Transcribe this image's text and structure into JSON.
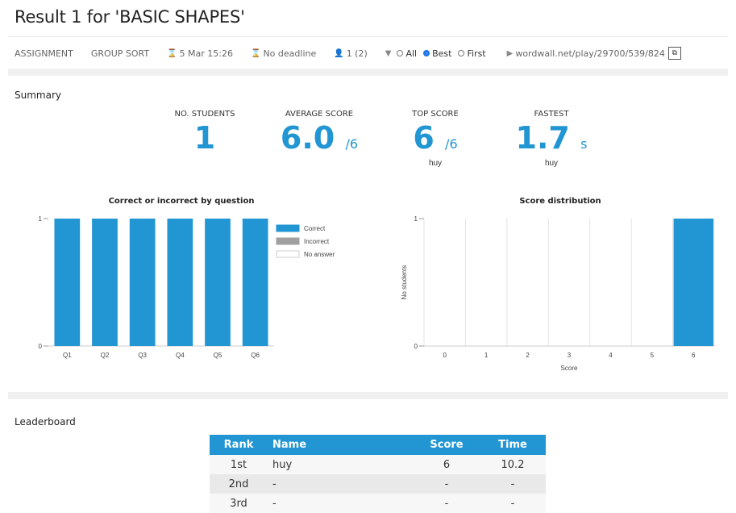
{
  "title": "Result 1 for 'BASIC SHAPES'",
  "meta": {
    "mode": "ASSIGNMENT",
    "template": "GROUP SORT",
    "started": "5 Mar 15:26",
    "deadline": "No deadline",
    "participants": "1 (2)",
    "filter_all": "All",
    "filter_best": "Best",
    "filter_first": "First",
    "link": "wordwall.net/play/29700/539/824"
  },
  "summary": {
    "label": "Summary",
    "students": {
      "header": "NO. STUDENTS",
      "value": "1"
    },
    "average": {
      "header": "AVERAGE SCORE",
      "value": "6.0",
      "unit": "/6"
    },
    "top": {
      "header": "TOP SCORE",
      "value": "6",
      "unit": "/6",
      "who": "huy"
    },
    "fastest": {
      "header": "FASTEST",
      "value": "1.7",
      "unit": "s",
      "who": "huy"
    }
  },
  "chart_data": [
    {
      "type": "bar",
      "title": "Correct or incorrect by question",
      "categories": [
        "Q1",
        "Q2",
        "Q3",
        "Q4",
        "Q5",
        "Q6"
      ],
      "series": [
        {
          "name": "Correct",
          "values": [
            1,
            1,
            1,
            1,
            1,
            1
          ],
          "color": "#2196d3"
        },
        {
          "name": "Incorrect",
          "values": [
            0,
            0,
            0,
            0,
            0,
            0
          ],
          "color": "#a0a0a0"
        },
        {
          "name": "No answer",
          "values": [
            0,
            0,
            0,
            0,
            0,
            0
          ],
          "color": "#ffffff"
        }
      ],
      "ylim": [
        0,
        1
      ],
      "yticks": [
        "0",
        "1"
      ],
      "legend": "right"
    },
    {
      "type": "bar",
      "title": "Score distribution",
      "categories": [
        "0",
        "1",
        "2",
        "3",
        "4",
        "5",
        "6"
      ],
      "values": [
        0,
        0,
        0,
        0,
        0,
        0,
        1
      ],
      "xlabel": "Score",
      "ylabel": "No students",
      "ylim": [
        0,
        1
      ],
      "yticks": [
        "0",
        "1"
      ],
      "grid": true,
      "color": "#2196d3"
    }
  ],
  "leaderboard": {
    "label": "Leaderboard",
    "headers": {
      "rank": "Rank",
      "name": "Name",
      "score": "Score",
      "time": "Time"
    },
    "rows": [
      {
        "rank": "1st",
        "name": "huy",
        "score": "6",
        "time": "10.2"
      },
      {
        "rank": "2nd",
        "name": "-",
        "score": "-",
        "time": "-"
      },
      {
        "rank": "3rd",
        "name": "-",
        "score": "-",
        "time": "-"
      }
    ]
  }
}
